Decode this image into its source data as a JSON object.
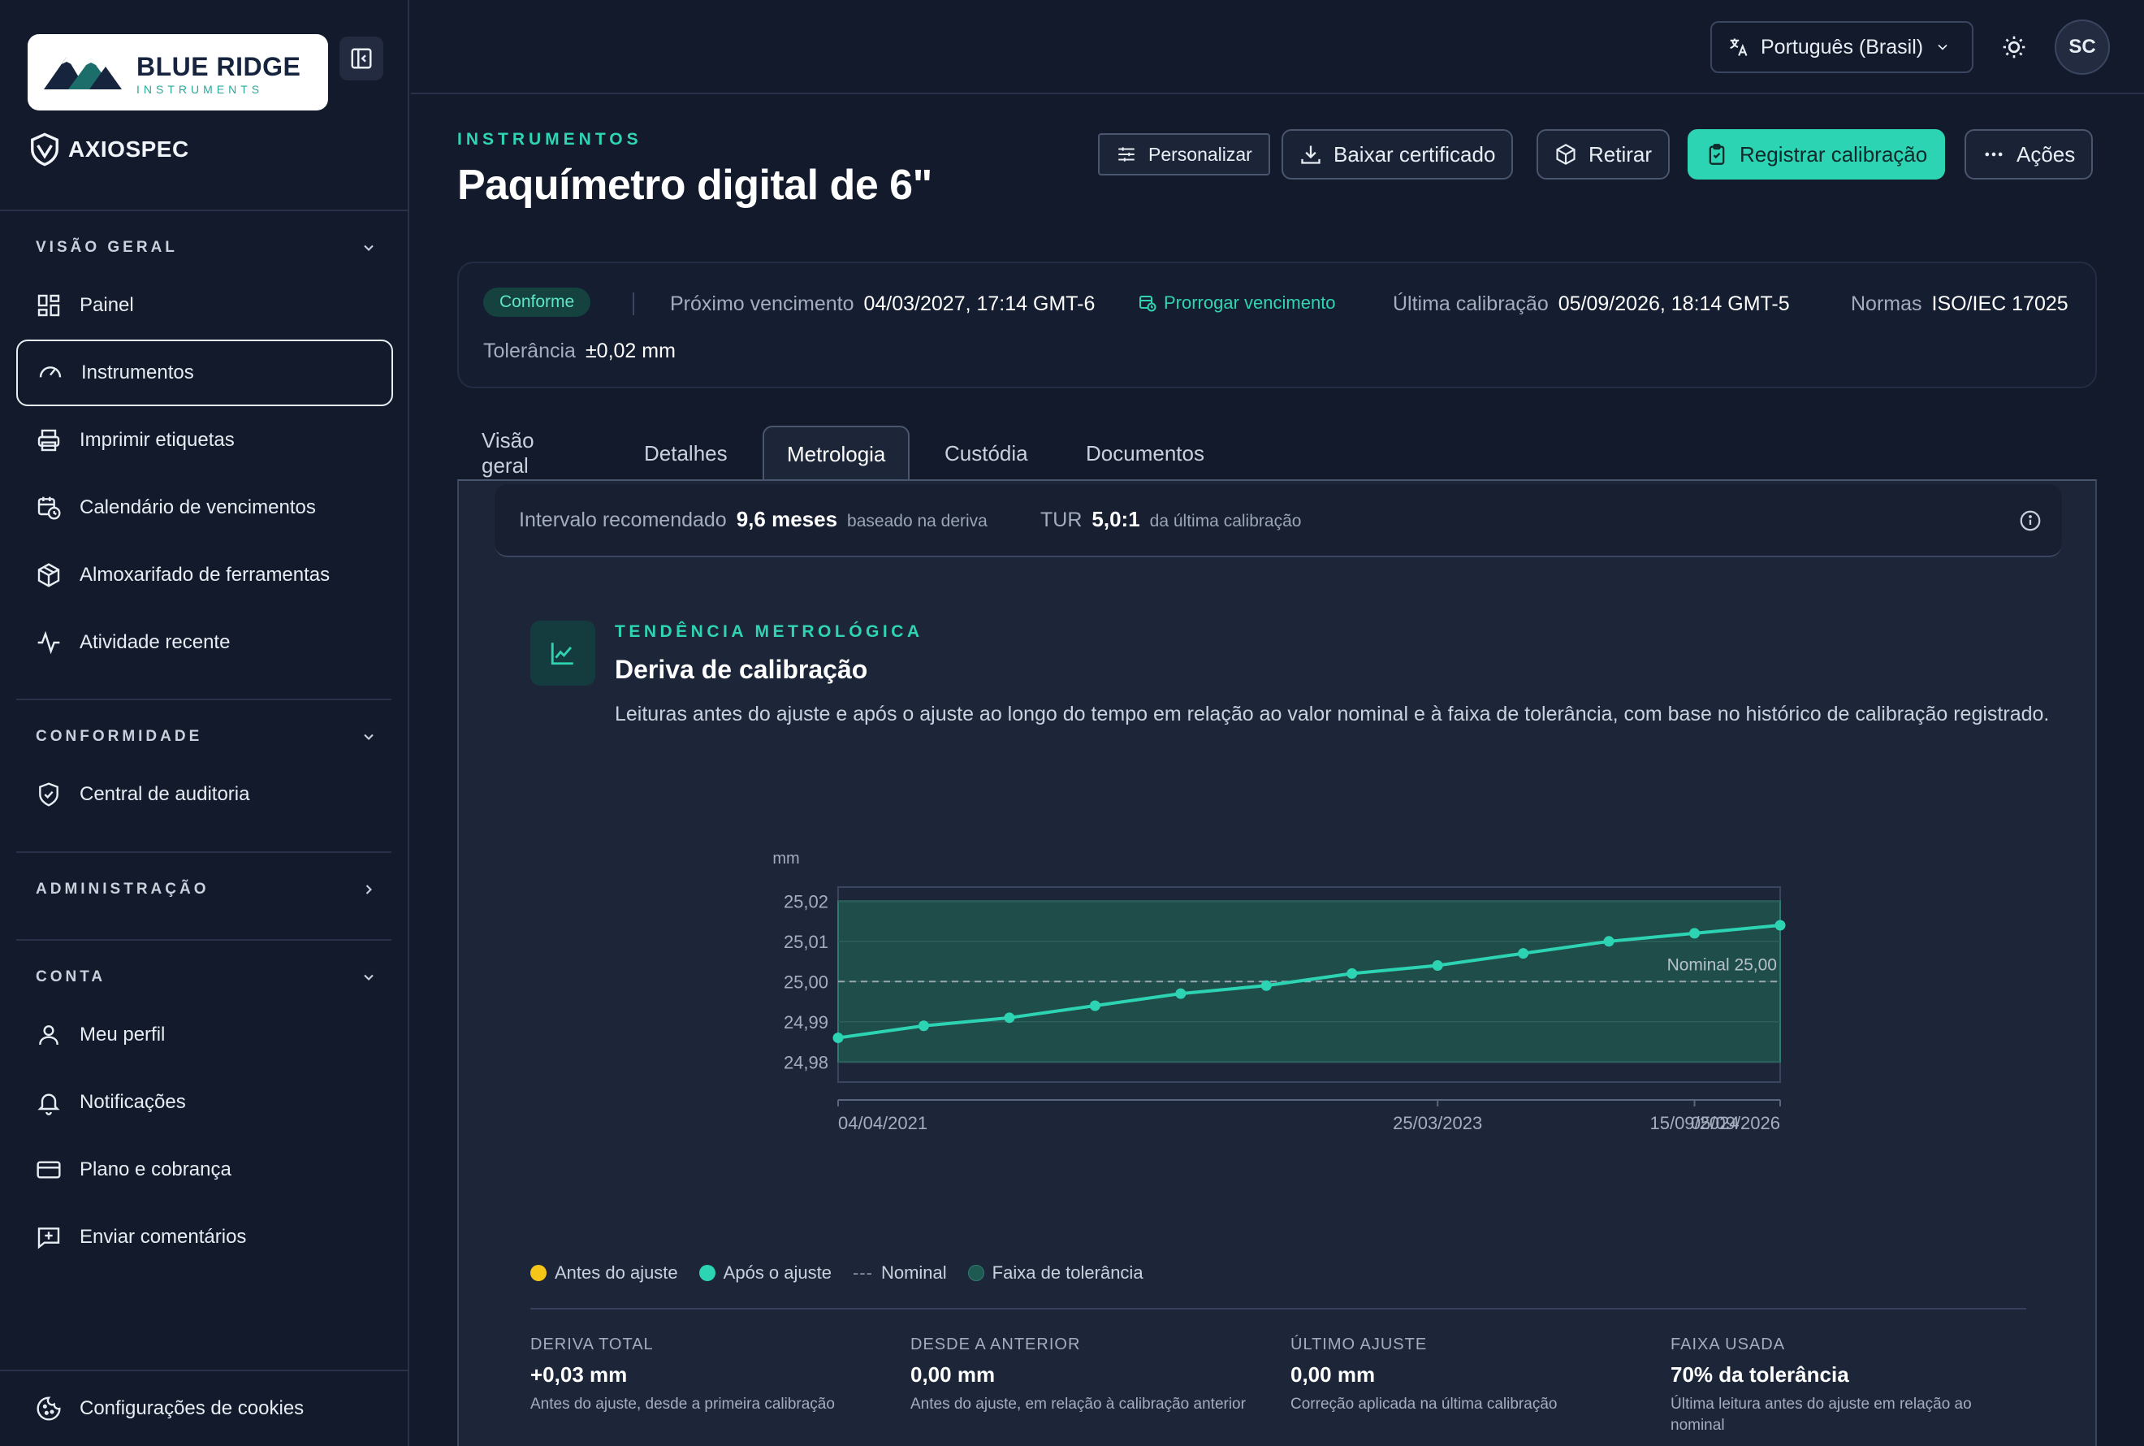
{
  "sidebar": {
    "logo": {
      "title": "BLUE RIDGE",
      "subtitle": "INSTRUMENTS"
    },
    "brand": "AXIOSPEC",
    "sections": {
      "overview": "VISÃO GERAL",
      "compliance": "CONFORMIDADE",
      "admin": "ADMINISTRAÇÃO",
      "account": "CONTA"
    },
    "items": {
      "dashboard": "Painel",
      "instruments": "Instrumentos",
      "labels": "Imprimir etiquetas",
      "calendar": "Calendário de vencimentos",
      "warehouse": "Almoxarifado de ferramentas",
      "activity": "Atividade recente",
      "audit": "Central de auditoria",
      "profile": "Meu perfil",
      "notifications": "Notificações",
      "billing": "Plano e cobrança",
      "feedback": "Enviar comentários",
      "cookies": "Configurações de cookies"
    }
  },
  "topbar": {
    "language": "Português (Brasil)",
    "avatar_initials": "SC"
  },
  "header": {
    "eyebrow": "INSTRUMENTOS",
    "title": "Paquímetro digital de 6\"",
    "buttons": {
      "customize": "Personalizar",
      "download": "Baixar certificado",
      "checkout": "Retirar",
      "register": "Registrar calibração",
      "actions": "Ações"
    }
  },
  "info": {
    "status": "Conforme",
    "next_due_label": "Próximo vencimento",
    "next_due_value": "04/03/2027, 17:14 GMT-6",
    "extend_link": "Prorrogar vencimento",
    "last_cal_label": "Última calibração",
    "last_cal_value": "05/09/2026, 18:14 GMT-5",
    "standards_label": "Normas",
    "standards_value": "ISO/IEC 17025",
    "tolerance_label": "Tolerância",
    "tolerance_value": "±0,02 mm"
  },
  "tabs": [
    "Visão geral",
    "Detalhes",
    "Metrologia",
    "Custódia",
    "Documentos"
  ],
  "strip": {
    "interval_label": "Intervalo recomendado",
    "interval_value": "9,6 meses",
    "interval_note": "baseado na deriva",
    "tur_label": "TUR",
    "tur_value": "5,0:1",
    "tur_note": "da última calibração"
  },
  "chart_section": {
    "eyebrow": "TENDÊNCIA METROLÓGICA",
    "title": "Deriva de calibração",
    "description": "Leituras antes do ajuste e após o ajuste ao longo do tempo em relação ao valor nominal e à faixa de tolerância, com base no histórico de calibração registrado."
  },
  "chart_data": {
    "type": "line",
    "ylabel": "mm",
    "ylim": [
      24.975,
      25.0235
    ],
    "yticks": [
      "25,02",
      "25,01",
      "25,00",
      "24,99",
      "24,98"
    ],
    "ytick_values": [
      25.02,
      25.01,
      25.0,
      24.99,
      24.98
    ],
    "xticks": [
      "04/04/2021",
      "25/03/2023",
      "15/09/2024",
      "05/09/2026"
    ],
    "xtick_values": [
      0,
      7,
      10,
      11
    ],
    "x_range": [
      0,
      11
    ],
    "nominal": {
      "value": 25.0,
      "label": "Nominal 25,00"
    },
    "tolerance_band": [
      24.98,
      25.02
    ],
    "series": [
      {
        "name": "Após o ajuste",
        "color": "#2dd4b4",
        "x": [
          0,
          1,
          2,
          3,
          4,
          5,
          6,
          7,
          8,
          9,
          10,
          11
        ],
        "values": [
          24.986,
          24.989,
          24.991,
          24.994,
          24.997,
          24.999,
          25.002,
          25.004,
          25.007,
          25.01,
          25.012,
          25.014
        ]
      }
    ],
    "legend": [
      {
        "label": "Antes do ajuste",
        "color": "#f5c518",
        "kind": "dot"
      },
      {
        "label": "Após o ajuste",
        "color": "#2dd4b4",
        "kind": "dot"
      },
      {
        "label": "Nominal",
        "color": "#8a94a6",
        "kind": "dash"
      },
      {
        "label": "Faixa de tolerância",
        "color": "#1f5a52",
        "kind": "dot"
      }
    ]
  },
  "stats": [
    {
      "label": "DERIVA TOTAL",
      "value": "+0,03 mm",
      "desc": "Antes do ajuste, desde a primeira calibração"
    },
    {
      "label": "DESDE A ANTERIOR",
      "value": "0,00 mm",
      "desc": "Antes do ajuste, em relação à calibração anterior"
    },
    {
      "label": "ÚLTIMO AJUSTE",
      "value": "0,00 mm",
      "desc": "Correção aplicada na última calibração"
    },
    {
      "label": "FAIXA USADA",
      "value": "70% da tolerância",
      "desc": "Última leitura antes do ajuste em relação ao nominal"
    }
  ]
}
